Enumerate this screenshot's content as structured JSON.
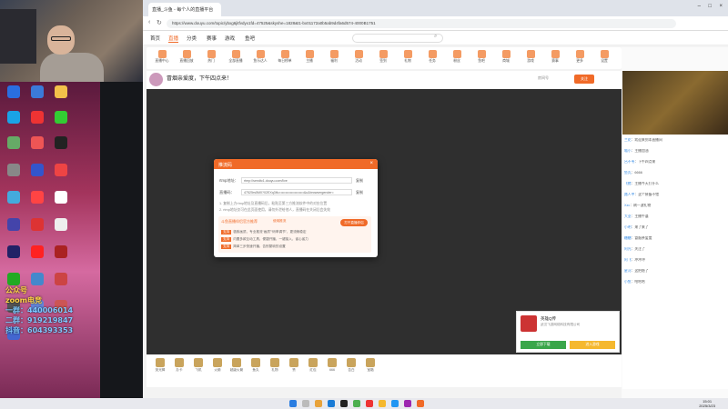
{
  "browser": {
    "tab_title": "直播_斗鱼 - 每个人的直播平台",
    "url": "https://www.douyu.com/topic/ybxg6jitfvdyx1fd=47525&skyshe=1828&t1-bx01172a0b5ab9d4fa6d574-4000B1751"
  },
  "site_nav": {
    "items": [
      "首页",
      "直播",
      "分类",
      "赛事",
      "游戏",
      "鱼吧"
    ]
  },
  "categories": [
    "直播中心",
    "直播回放",
    "热门",
    "全部直播",
    "鱼乐达人",
    "每日榜单",
    "主播",
    "福利",
    "活动",
    "签到",
    "礼物",
    "任务",
    "粉丝",
    "鱼吧",
    "商城",
    "游戏",
    "赛事",
    "更多",
    "设置"
  ],
  "stream": {
    "title": "冒烟亲爱度，下午四点来！",
    "room_label": "房间号",
    "follow_label": "关注"
  },
  "modal": {
    "title": "推流码",
    "close": "×",
    "rtmp_label": "rtmp地址：",
    "rtmp_value": "rtmp://sendtc1.douyu.com/live",
    "key_label": "直播码：",
    "key_value": "47525rs5M0?02EXq3lfu=••••••••••••••••••••&u&browsergender=",
    "copy_label": "复制",
    "note1": "1. 复制上方rtmp地址及直播码后，粘贴至第三方推流软件中的对应位置",
    "note2": "2. rtmp地址仅可在此页面使用，请勿外泄给他人，直播码在关闭后会失效",
    "promo_title": "斗鱼直播伴侣官方推荐",
    "promo_sub": "使用推流",
    "promo_button": "打开直播伴侣",
    "promo_lines": [
      [
        "支持",
        "极致画质，专业推流“画质”“码率调节”，更流畅稳定"
      ],
      [
        "支持",
        "内置多款互动工具，便捷开播，一键接入，省心省力"
      ],
      [
        "支持",
        "简单三步快速开播，告别繁琐的设置"
      ]
    ]
  },
  "ad_card": {
    "name": "英雄Q传",
    "company": "武汉飞游网络科技有限公司",
    "btn1": "立即下载",
    "btn2": "进入游戏"
  },
  "chat": [
    {
      "user": "兰花",
      "text": "欢迎来到本直播间"
    },
    {
      "user": "喵小",
      "text": "主播加油"
    },
    {
      "user": "吕不韦",
      "text": "下午四点来"
    },
    {
      "user": "鱼丸",
      "text": "6666"
    },
    {
      "user": "飞猪",
      "text": "主播今天打什么"
    },
    {
      "user": "路人甲",
      "text": "这个装备不错"
    },
    {
      "user": "Xzc",
      "text": "刷一波礼物"
    },
    {
      "user": "大圣",
      "text": "主播牛逼"
    },
    {
      "user": "小明",
      "text": "来了来了"
    },
    {
      "user": "糖糖",
      "text": "冒烟亲爱度"
    },
    {
      "user": "阿光",
      "text": "关注了"
    },
    {
      "user": "阿飞",
      "text": "冲冲冲"
    },
    {
      "user": "星河",
      "text": "这把稳了"
    },
    {
      "user": "小鱼",
      "text": "哈哈哈"
    }
  ],
  "gifts": [
    "荧光棒",
    "办卡",
    "飞机",
    "火箭",
    "超级火箭",
    "鱼丸",
    "礼物",
    "赞",
    "红包",
    "666",
    "告白",
    "宝箱"
  ],
  "desktop": {
    "text_lines": [
      "公众号",
      "zoom电竞",
      "一群：440006014",
      "二群：919219847",
      "抖音：604393353"
    ]
  },
  "taskbar": {
    "time": "15:01",
    "date": "2025/3/23"
  },
  "colors": {
    "accent": "#f06a28",
    "player_bg": "#2f2f2f"
  }
}
